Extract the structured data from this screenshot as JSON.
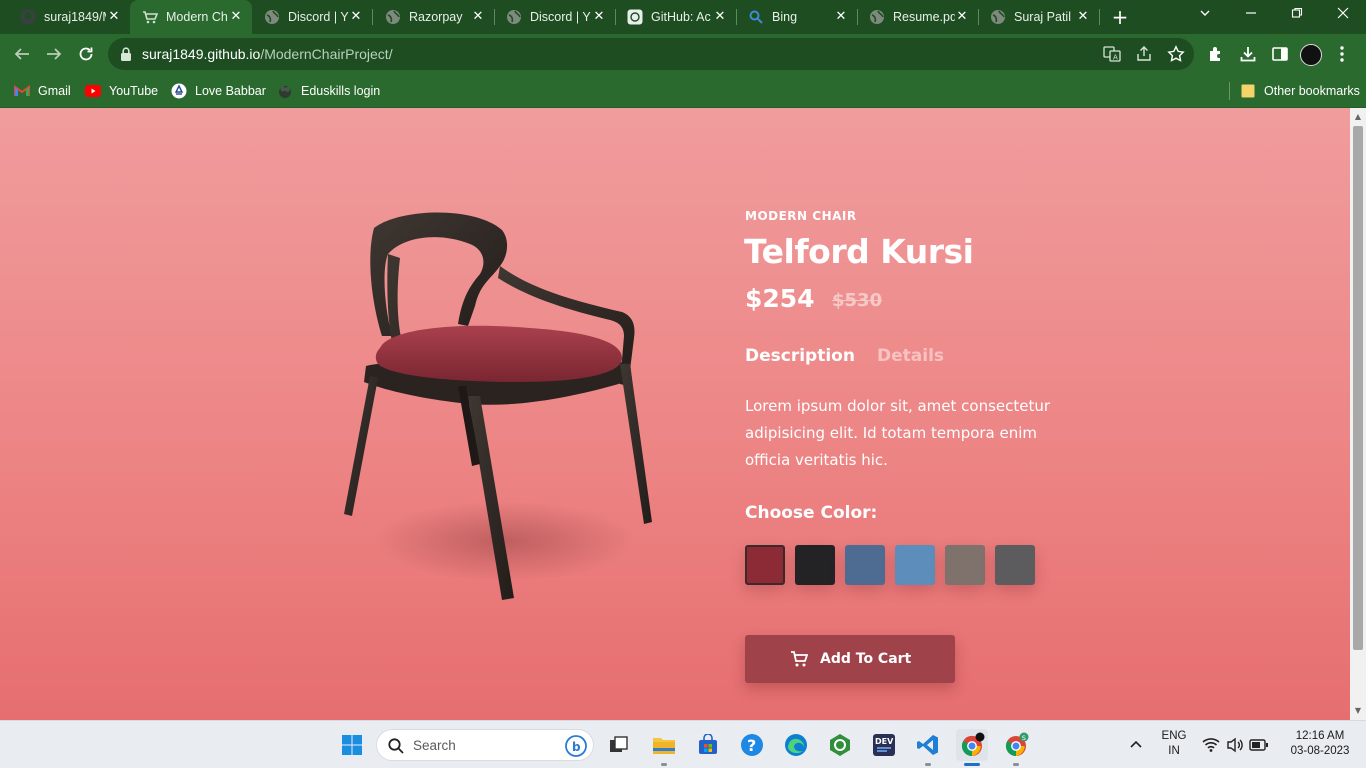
{
  "browser": {
    "tabs": [
      {
        "title": "suraj1849/M",
        "active": false
      },
      {
        "title": "Modern Ch",
        "active": true
      },
      {
        "title": "Discord | Y",
        "active": false
      },
      {
        "title": "Razorpay",
        "active": false
      },
      {
        "title": "Discord | Y",
        "active": false
      },
      {
        "title": "GitHub: Ac",
        "active": false
      },
      {
        "title": "Bing",
        "active": false
      },
      {
        "title": "Resume.pd",
        "active": false
      },
      {
        "title": "Suraj Patil",
        "active": false
      }
    ],
    "url_domain": "suraj1849.github.io",
    "url_path": "/ModernChairProject/",
    "bookmarks": [
      {
        "label": "Gmail"
      },
      {
        "label": "YouTube"
      },
      {
        "label": "Love Babbar"
      },
      {
        "label": "Eduskills login"
      }
    ],
    "other_bookmarks": "Other bookmarks"
  },
  "product": {
    "eyebrow": "MODERN CHAIR",
    "title": "Telford Kursi",
    "price": "$254",
    "old_price": "$530",
    "tabs": {
      "description": "Description",
      "details": "Details"
    },
    "description": "Lorem ipsum dolor sit, amet consectetur adipisicing elit. Id totam tempora enim officia veritatis hic.",
    "color_label": "Choose Color:",
    "colors": [
      {
        "name": "red-fabric",
        "hex": "#8c2a36",
        "selected": true
      },
      {
        "name": "black-fabric",
        "hex": "#232325",
        "selected": false
      },
      {
        "name": "denim-dark",
        "hex": "#4e6c92",
        "selected": false
      },
      {
        "name": "denim-light",
        "hex": "#5d8dba",
        "selected": false
      },
      {
        "name": "taupe-fabric",
        "hex": "#7f716b",
        "selected": false
      },
      {
        "name": "grey-fabric",
        "hex": "#5c5c5e",
        "selected": false
      }
    ],
    "cart_button": "Add To Cart",
    "accent": "#9f4249"
  },
  "taskbar": {
    "search_placeholder": "Search",
    "language": "ENG",
    "region": "IN",
    "time": "12:16 AM",
    "date": "03-08-2023"
  }
}
